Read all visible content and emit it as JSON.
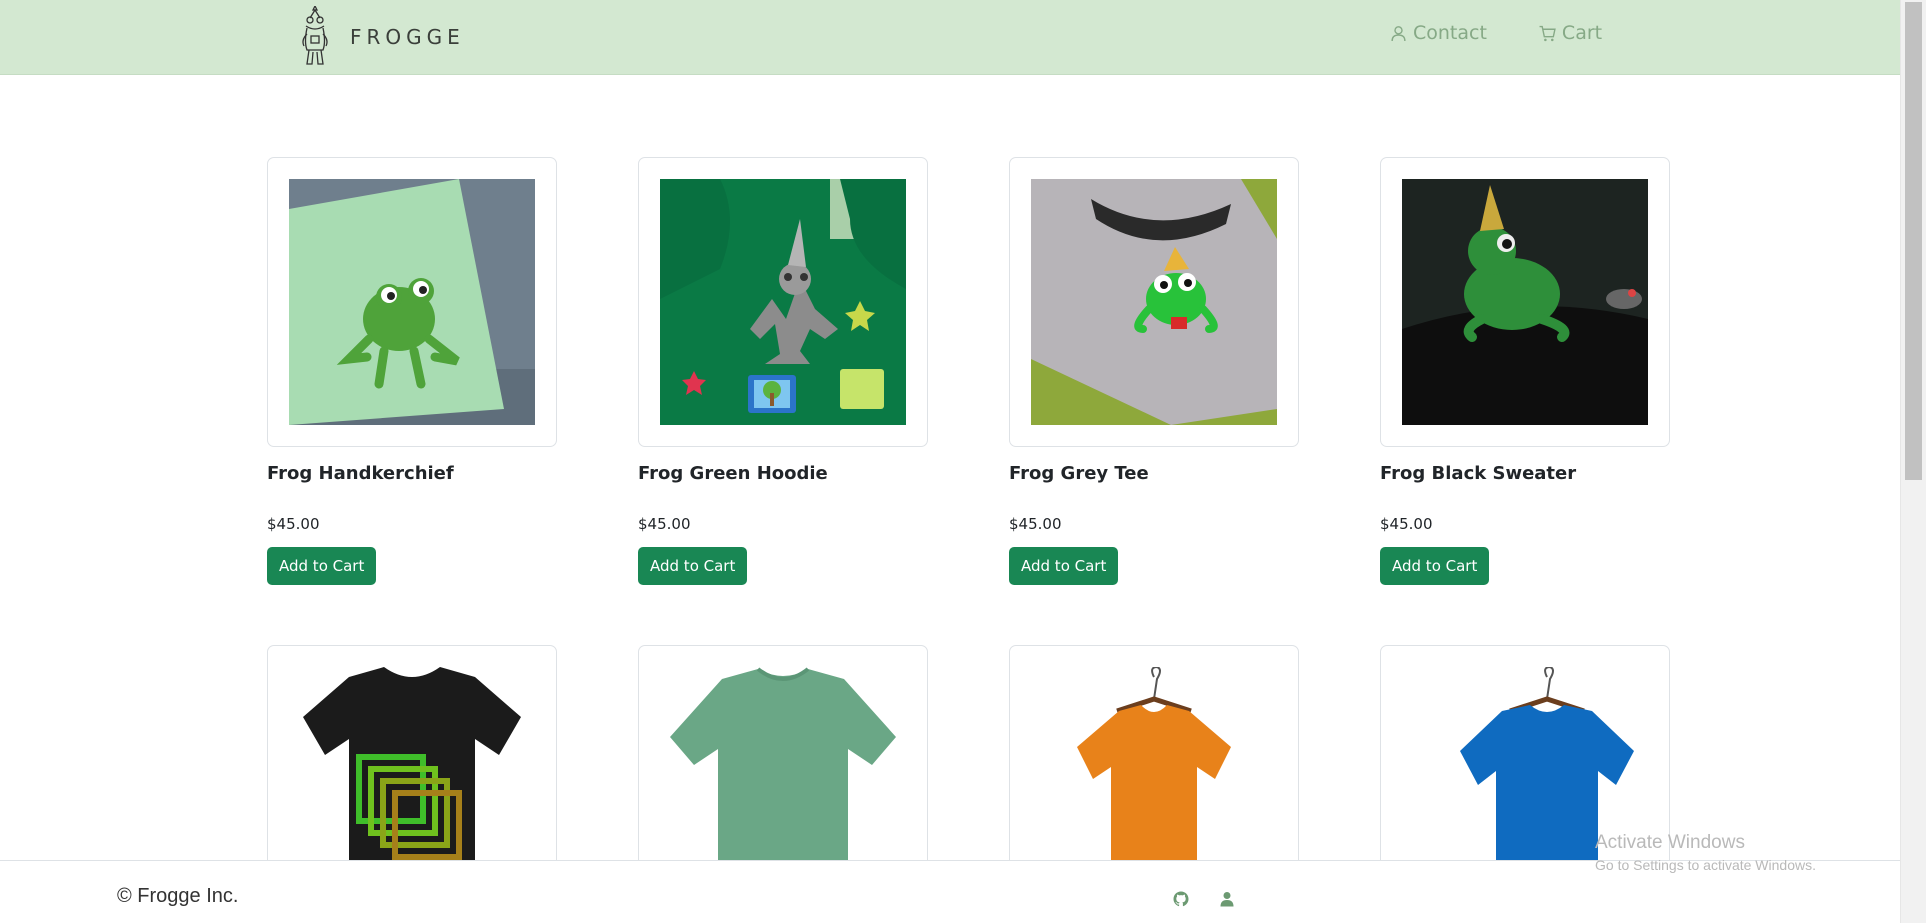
{
  "brand": {
    "name": "FROGGE",
    "logo_icon": "frog-mascot-icon"
  },
  "nav": {
    "contact": {
      "label": "Contact",
      "icon": "user-icon"
    },
    "cart": {
      "label": "Cart",
      "icon": "cart-icon"
    }
  },
  "products": [
    {
      "name": "Frog Handkerchief",
      "price": "$45.00",
      "button": "Add to Cart",
      "image": "handkerchief"
    },
    {
      "name": "Frog Green Hoodie",
      "price": "$45.00",
      "button": "Add to Cart",
      "image": "hoodie"
    },
    {
      "name": "Frog Grey Tee",
      "price": "$45.00",
      "button": "Add to Cart",
      "image": "greytee"
    },
    {
      "name": "Frog Black Sweater",
      "price": "$45.00",
      "button": "Add to Cart",
      "image": "sweater"
    },
    {
      "name": "",
      "price": "",
      "button": "",
      "image": "blacktee"
    },
    {
      "name": "",
      "price": "",
      "button": "",
      "image": "greentee"
    },
    {
      "name": "",
      "price": "",
      "button": "",
      "image": "orangetee"
    },
    {
      "name": "",
      "price": "",
      "button": "",
      "image": "bluetee"
    }
  ],
  "footer": {
    "copyright": "© Frogge Inc.",
    "icons": [
      "github-icon",
      "user-icon"
    ]
  },
  "watermark": {
    "title": "Activate Windows",
    "subtitle": "Go to Settings to activate Windows."
  },
  "colors": {
    "header_bg": "#d3e8d1",
    "nav_link": "#86a986",
    "button": "#198754"
  }
}
